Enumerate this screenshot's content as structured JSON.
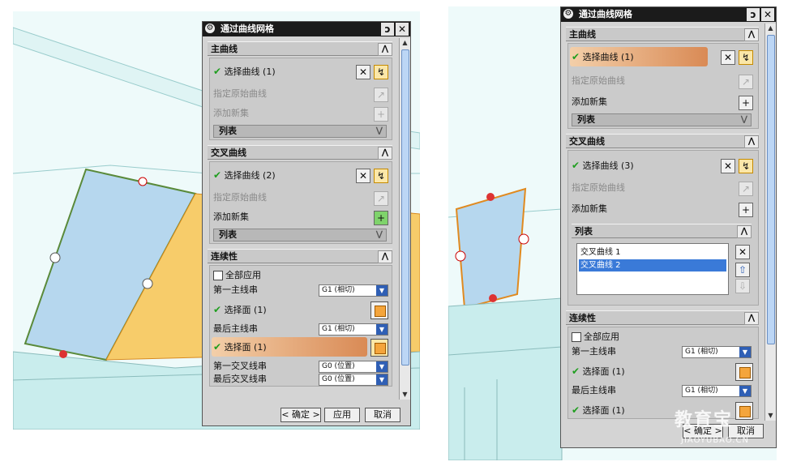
{
  "left": {
    "dialog_title": "通过曲线网格",
    "reset_icon": "ↄ",
    "close_icon": "✕",
    "primary_header": "主曲线",
    "primary_select": "选择曲线 (1)",
    "primary_origin": "指定原始曲线",
    "primary_add": "添加新集",
    "primary_list": "列表",
    "cross_header": "交叉曲线",
    "cross_select": "选择曲线 (2)",
    "cross_origin": "指定原始曲线",
    "cross_add": "添加新集",
    "cross_list": "列表",
    "cont_header": "连续性",
    "apply_all": "全部应用",
    "first_primary": "第一主线串",
    "first_primary_val": "G1 (相切)",
    "select_face1": "选择面 (1)",
    "last_primary": "最后主线串",
    "last_primary_val": "G1 (相切)",
    "select_face2": "选择面 (1)",
    "first_cross": "第一交叉线串",
    "first_cross_val": "G0 (位置)",
    "last_cross": "最后交叉线串",
    "last_cross_val": "G0 (位置)",
    "ok": "< 确定 >",
    "apply": "应用",
    "cancel": "取消"
  },
  "right": {
    "dialog_title": "通过曲线网格",
    "primary_header": "主曲线",
    "primary_select": "选择曲线 (1)",
    "primary_origin": "指定原始曲线",
    "primary_add": "添加新集",
    "primary_list": "列表",
    "cross_header": "交叉曲线",
    "cross_select": "选择曲线 (3)",
    "cross_origin": "指定原始曲线",
    "cross_add": "添加新集",
    "list_header": "列表",
    "list_items": [
      "交叉曲线 1",
      "交叉曲线 2"
    ],
    "cont_header": "连续性",
    "apply_all": "全部应用",
    "first_primary": "第一主线串",
    "first_primary_val": "G1 (相切)",
    "select_face1": "选择面 (1)",
    "last_primary": "最后主线串",
    "last_primary_val": "G1 (相切)",
    "select_face2": "选择面 (1)",
    "ok": "< 确定 >",
    "cancel": "取消"
  },
  "watermark": "教育宝",
  "watermark_url": "JIAOYUBAO.CN",
  "icons": {
    "gear": "gear-icon",
    "reset": "reset-icon",
    "close": "close-icon",
    "select_curve": "curve-select-icon",
    "deselect": "deselect-icon",
    "origin": "origin-curve-icon",
    "add": "add-set-icon",
    "face": "face-select-icon"
  },
  "colors": {
    "titlebar": "#1b1b1b",
    "highlight_start": "#f3cfa9",
    "highlight_end": "#d98a55",
    "check": "#1f9e1f",
    "surface_blue": "#b6d7ee",
    "surface_yellow": "#f7cc6a"
  }
}
